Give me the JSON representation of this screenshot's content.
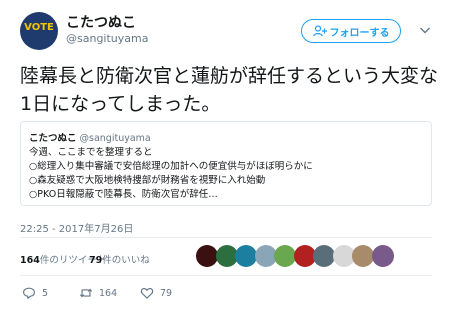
{
  "header": {
    "avatar_text": "VOTE",
    "display_name": "こたつぬこ",
    "screen_name": "@sangituyama",
    "follow_label": "フォローする"
  },
  "tweet": {
    "text": "陸幕長と防衛次官と蓮舫が辞任するという大変な1日になってしまった。"
  },
  "quote": {
    "name": "こたつぬこ",
    "handle": "@sangituyama",
    "lines": [
      "今週、ここまでを整理すると",
      "○総理入り集中審議で安倍総理の加計への便宜供与がほぼ明らかに",
      "○森友疑惑で大阪地検特捜部が財務省を視野に入れ始動",
      "○PKO日報隠蔽で陸幕長、防衛次官が辞任…"
    ]
  },
  "timestamp": "22:25 - 2017年7月26日",
  "stats": {
    "retweet_count": "164",
    "retweet_label": "件のリツイート",
    "like_count": "79",
    "like_label": "件のいいね"
  },
  "likers": [
    {
      "icon": "liker-avatar-1",
      "color": "#3a1010"
    },
    {
      "icon": "liker-avatar-2",
      "color": "#2c6e3f"
    },
    {
      "icon": "liker-avatar-3",
      "color": "#1c7fa0"
    },
    {
      "icon": "liker-avatar-4",
      "color": "#8aa4b8"
    },
    {
      "icon": "liker-avatar-5",
      "color": "#6aa84f"
    },
    {
      "icon": "liker-avatar-6",
      "color": "#b32020"
    },
    {
      "icon": "liker-avatar-7",
      "color": "#5a6e7a"
    },
    {
      "icon": "liker-avatar-8",
      "color": "#d8d8d8"
    },
    {
      "icon": "liker-avatar-9",
      "color": "#a88b6a"
    },
    {
      "icon": "liker-avatar-10",
      "color": "#7a5a8a"
    }
  ],
  "actions": {
    "reply_count": "5",
    "retweet_count": "164",
    "like_count": "79"
  },
  "colors": {
    "accent": "#1da1f2",
    "muted": "#657786",
    "text": "#14171a"
  }
}
